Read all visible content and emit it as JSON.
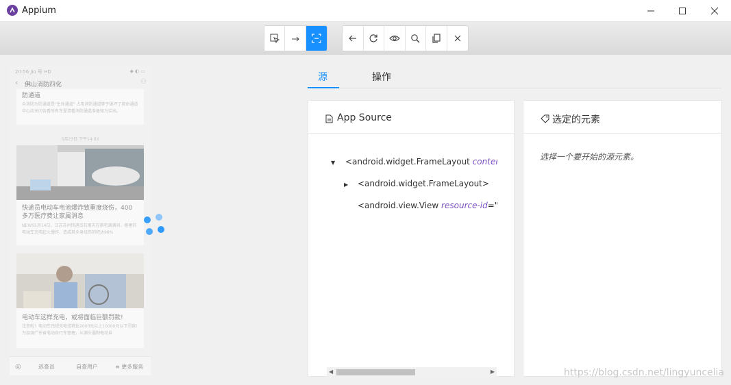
{
  "window": {
    "title": "Appium",
    "controls": [
      "minimize-icon",
      "maximize-icon",
      "close-icon"
    ]
  },
  "toolbar": {
    "group1": [
      "select-element-icon",
      "swipe-by-coordinates-icon",
      "tap-by-coordinates-icon"
    ],
    "group2": [
      "back-arrow-icon",
      "refresh-icon",
      "eye-icon",
      "search-icon",
      "copy-icon",
      "close-icon"
    ],
    "active_button": "tap-by-coordinates-icon",
    "accent_color": "#1890ff"
  },
  "device": {
    "status_time": "20:56 Jio 号 HD",
    "nav_title": "佛山消防四化",
    "card1_head": "防通道",
    "card1_text": "众消防为防通道是\"生命通道\" 占用消防通道等于破坏了救命通道中心应关问告看所有车里请看消防通道准备知为实出。",
    "timestamp": "5月23日 下午14:03",
    "card2_head": "快递员电动车电池爆炸致重度烧伤，400 多万医疗费让家属消息",
    "card2_text": "NEWS5月14日，江苏苏州快递员石雨天在宿宅满满间，租屋的电动车充电起火爆炸，造成其全身烧伤的积达98%",
    "card3_head": "电动车这样充电，或将面临巨额罚款!",
    "card3_text": "注意啦！电动车违规充电或将处2000元以上10000元以下罚款! 为加强广东省电动自行车管理，从源头遏制电动自",
    "bottom_items": [
      "巡查员",
      "自查用户",
      "≡ 更多服务"
    ]
  },
  "tabs": [
    {
      "label": "源",
      "active": true
    },
    {
      "label": "操作",
      "active": false
    }
  ],
  "source_panel": {
    "title": "App Source",
    "icon": "file-icon",
    "nodes": [
      {
        "caret": "▼",
        "tag": "<android.widget.FrameLayout ",
        "attr": "content-des"
      },
      {
        "caret": "▶",
        "tag": "<android.widget.FrameLayout>",
        "attr": ""
      },
      {
        "caret": "",
        "tag": "<android.view.View ",
        "attr": "resource-id",
        "value": "=\"andro"
      }
    ]
  },
  "selected_panel": {
    "title": "选定的元素",
    "icon": "tag-icon",
    "hint": "选择一个要开始的源元素。"
  },
  "watermark": "https://blog.csdn.net/lingyuncelia"
}
